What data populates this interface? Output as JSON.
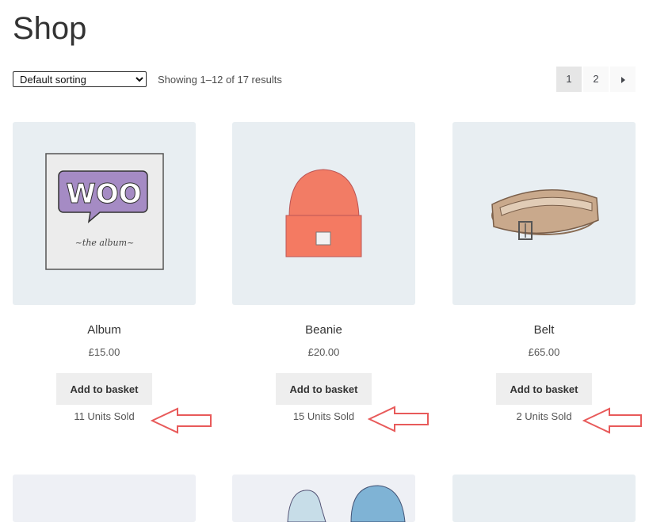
{
  "page": {
    "title": "Shop"
  },
  "toolbar": {
    "sort_selected": "Default sorting",
    "result_count": "Showing 1–12 of 17 results"
  },
  "pagination": {
    "pages": [
      "1",
      "2"
    ],
    "current": "1"
  },
  "products": [
    {
      "name": "Album",
      "price": "£15.00",
      "button": "Add to basket",
      "sold": "11 Units Sold",
      "image_text": "WOO",
      "image_caption": "~the  album~"
    },
    {
      "name": "Beanie",
      "price": "£20.00",
      "button": "Add to basket",
      "sold": "15 Units Sold"
    },
    {
      "name": "Belt",
      "price": "£65.00",
      "button": "Add to basket",
      "sold": "2 Units Sold"
    }
  ],
  "colors": {
    "accent_arrow": "#e85a5a",
    "card_background": "#e8eef2",
    "button_background": "#eeeeee",
    "album_purple": "#a58bc4",
    "beanie_orange": "#f27c65",
    "belt_tan": "#c9a98c"
  }
}
